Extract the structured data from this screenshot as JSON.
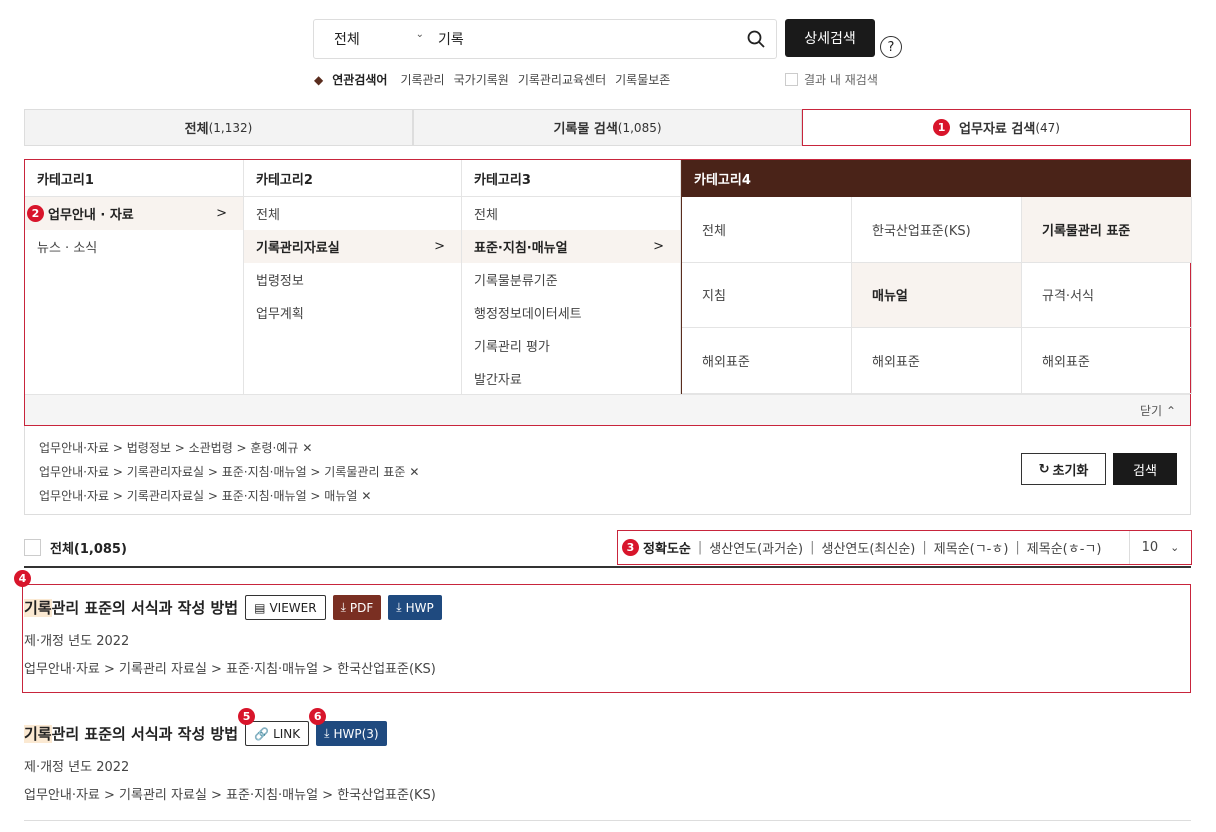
{
  "search": {
    "scope": "전체",
    "query": "기록",
    "detail_label": "상세검색",
    "help": "?"
  },
  "related": {
    "label": "연관검색어",
    "terms": [
      "기록관리",
      "국가기록원",
      "기록관리교육센터",
      "기록물보존"
    ],
    "within_label": "결과 내 재검색"
  },
  "tabs": [
    {
      "label": "전체",
      "count": "(1,132)"
    },
    {
      "label": "기록물 검색",
      "count": "(1,085)"
    },
    {
      "label": "업무자료 검색",
      "count": "(47)"
    }
  ],
  "markers": [
    "1",
    "2",
    "3",
    "4",
    "5",
    "6"
  ],
  "categories": {
    "cat1": {
      "head": "카테고리1",
      "items": [
        "업무안내 · 자료",
        "뉴스 · 소식"
      ]
    },
    "cat2": {
      "head": "카테고리2",
      "items": [
        "전체",
        "기록관리자료실",
        "법령정보",
        "업무계획"
      ]
    },
    "cat3": {
      "head": "카테고리3",
      "items": [
        "전체",
        "표준·지침·매뉴얼",
        "기록물분류기준",
        "행정정보데이터세트",
        "기록관리 평가",
        "발간자료"
      ]
    },
    "cat4": {
      "head": "카테고리4",
      "items": [
        "전체",
        "한국산업표준(KS)",
        "기록물관리 표준",
        "지침",
        "매뉴얼",
        "규격·서식",
        "해외표준",
        "해외표준",
        "해외표준"
      ]
    },
    "close_label": "닫기"
  },
  "filters": {
    "lines": [
      "업무안내·자료 > 법령정보 > 소관법령 > 훈령·예규",
      "업무안내·자료 > 기록관리자료실 > 표준·지침·매뉴얼 > 기록물관리 표준",
      "업무안내·자료 > 기록관리자료실 > 표준·지침·매뉴얼 > 매뉴얼"
    ],
    "remove": "✕",
    "reset_label": "초기화",
    "search_label": "검색"
  },
  "results_header": {
    "all_label": "전체(1,085)",
    "sort": [
      "정확도순",
      "생산연도(과거순)",
      "생산연도(최신순)",
      "제목순(ㄱ-ㅎ)",
      "제목순(ㅎ-ㄱ)"
    ],
    "page_size": "10"
  },
  "results": [
    {
      "title_hl": "기록",
      "title_rest": "관리 표준의 서식과 작성 방법",
      "buttons": [
        "VIEWER",
        "PDF",
        "HWP"
      ],
      "meta": "제·개정 년도 2022",
      "path": "업무안내·자료 > 기록관리 자료실 > 표준·지침·매뉴얼 > 한국산업표준(KS)"
    },
    {
      "title_hl": "기록",
      "title_rest": "관리 표준의 서식과 작성 방법",
      "buttons": [
        "LINK",
        "HWP(3)"
      ],
      "meta": "제·개정 년도 2022",
      "path": "업무안내·자료 > 기록관리 자료실 > 표준·지침·매뉴얼 > 한국산업표준(KS)"
    }
  ],
  "colors": {
    "accent": "#c8253c",
    "brand_brown": "#4a2318",
    "pdf": "#7a2f22",
    "hwp": "#1f4a7f"
  }
}
